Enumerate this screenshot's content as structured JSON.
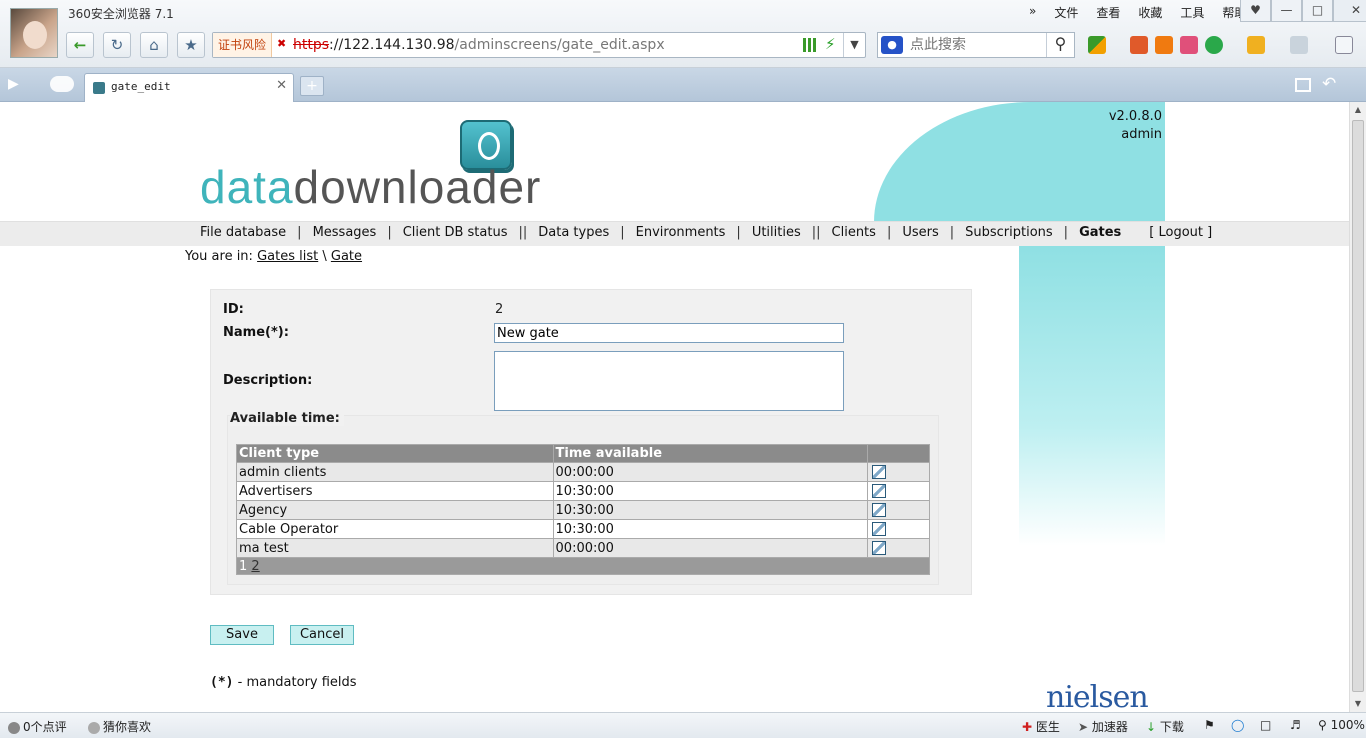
{
  "browser": {
    "title": "360安全浏览器 7.1",
    "menu": [
      "»",
      "文件",
      "查看",
      "收藏",
      "工具",
      "帮助"
    ],
    "cert_warning": "证书风险",
    "url_scheme": "https",
    "url_host": "://122.144.130.98",
    "url_path": "/adminscreens/gate_edit.aspx",
    "search_placeholder": "点此搜索",
    "tab_title": "gate_edit"
  },
  "page": {
    "version": "v2.0.8.0",
    "user": "admin",
    "logo_part1": "data",
    "logo_part2": "downloader",
    "nav": [
      {
        "label": "File database",
        "sep": "|"
      },
      {
        "label": "Messages",
        "sep": "|"
      },
      {
        "label": "Client DB status",
        "sep": "||"
      },
      {
        "label": "Data types",
        "sep": "|"
      },
      {
        "label": "Environments",
        "sep": "|"
      },
      {
        "label": "Utilities",
        "sep": "||"
      },
      {
        "label": "Clients",
        "sep": "|"
      },
      {
        "label": "Users",
        "sep": "|"
      },
      {
        "label": "Subscriptions",
        "sep": "|"
      },
      {
        "label": "Gates",
        "sep": ""
      },
      {
        "label": "[ Logout ]",
        "sep": ""
      }
    ],
    "active_nav": "Gates",
    "breadcrumb": {
      "prefix": "You are in:",
      "link1": "Gates list",
      "separator": "\\",
      "link2": "Gate"
    },
    "form": {
      "id_label": "ID:",
      "id_value": "2",
      "name_label": "Name(*):",
      "name_value": "New gate",
      "description_label": "Description:",
      "description_value": "",
      "available_time_legend": "Available time:"
    },
    "grid": {
      "headers": [
        "Client type",
        "Time available",
        ""
      ],
      "rows": [
        {
          "client_type": "admin clients",
          "time": "00:00:00"
        },
        {
          "client_type": "Advertisers",
          "time": "10:30:00"
        },
        {
          "client_type": "Agency",
          "time": "10:30:00"
        },
        {
          "client_type": "Cable Operator",
          "time": "10:30:00"
        },
        {
          "client_type": "ma test",
          "time": "00:00:00"
        }
      ],
      "pager_current": "1",
      "pager_next": "2"
    },
    "buttons": {
      "save": "Save",
      "cancel": "Cancel"
    },
    "footnote_mark": "(*)",
    "footnote_text": " - mandatory fields",
    "nielsen": "nielsen"
  },
  "statusbar": {
    "comments": "0个点评",
    "guess": "猜你喜欢",
    "doctor": "医生",
    "accelerator": "加速器",
    "download": "下载",
    "zoom": "100%"
  },
  "colors": {
    "accent": "#8fe0e3",
    "nav_bg": "#ececec",
    "grid_header": "#8b8b8b",
    "button_bg": "#c8f0f0"
  }
}
